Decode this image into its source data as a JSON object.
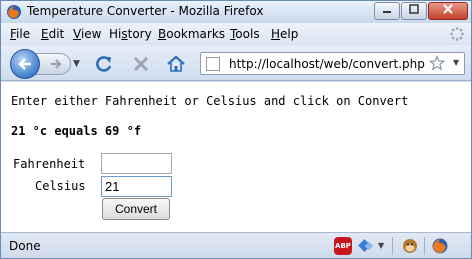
{
  "window": {
    "title": "Temperature Converter - Mozilla Firefox"
  },
  "menu": [
    {
      "acc": "F",
      "rest": "ile"
    },
    {
      "acc": "E",
      "rest": "dit"
    },
    {
      "acc": "V",
      "rest": "iew"
    },
    {
      "pre": "Hi",
      "acc": "s",
      "rest": "tory"
    },
    {
      "acc": "B",
      "rest": "ookmarks"
    },
    {
      "acc": "T",
      "rest": "ools"
    },
    {
      "acc": "H",
      "rest": "elp"
    }
  ],
  "navbar": {
    "url": "http://localhost/web/convert.php"
  },
  "page": {
    "instructions": "Enter either Fahrenheit or Celsius and click on Convert",
    "result": "21 °c equals 69 °f",
    "fahrenheit_label": "Fahrenheit",
    "celsius_label": "Celsius",
    "fahrenheit_value": "",
    "celsius_value": "21",
    "convert_label": "Convert"
  },
  "status": {
    "text": "Done",
    "abp_label": "ABP"
  },
  "colors": {
    "chrome": "#d3dff0",
    "close_button": "#c2412b",
    "abp_badge": "#c7171b"
  }
}
